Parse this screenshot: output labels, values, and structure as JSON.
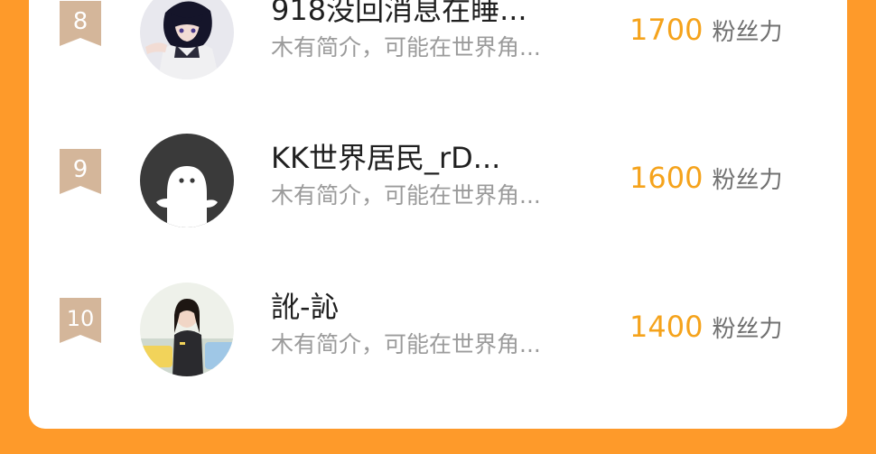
{
  "leaderboard": [
    {
      "rank": "8",
      "name": "918没回消息在睡...",
      "bio": "木有简介，可能在世界角...",
      "score": "1700",
      "score_unit": "粉丝力",
      "avatar": "anime-avatar"
    },
    {
      "rank": "9",
      "name": "KK世界居民_rD...",
      "bio": "木有简介，可能在世界角...",
      "score": "1600",
      "score_unit": "粉丝力",
      "avatar": "default-ghost-avatar"
    },
    {
      "rank": "10",
      "name": "訛-訫",
      "bio": "木有简介，可能在世界角...",
      "score": "1400",
      "score_unit": "粉丝力",
      "avatar": "photo-avatar"
    }
  ],
  "colors": {
    "page_background": "#fe9a2a",
    "score": "#f5a31c",
    "rank_badge": "#d4b69a"
  }
}
